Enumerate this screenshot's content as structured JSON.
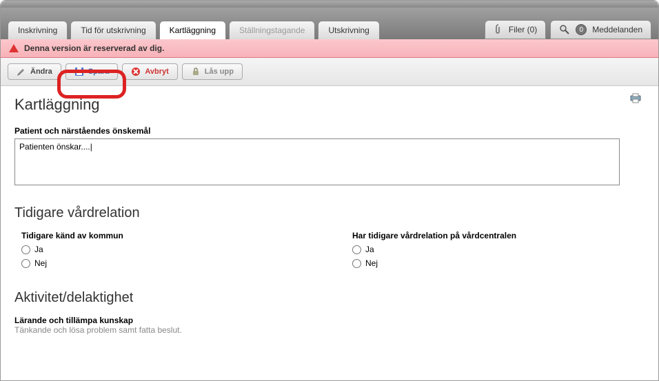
{
  "tabs": {
    "inskrivning": "Inskrivning",
    "tid": "Tid för utskrivning",
    "kartlaggning": "Kartläggning",
    "stallning": "Ställningstagande",
    "utskrivning": "Utskrivning"
  },
  "rightTabs": {
    "filer": "Filer (0)",
    "meddelanden": "Meddelanden",
    "meddelanden_count": "0"
  },
  "alert": {
    "message": "Denna version är reserverad av dig."
  },
  "toolbar": {
    "andra": "Ändra",
    "spara": "Spara",
    "avbryt": "Avbryt",
    "lasupp": "Lås upp"
  },
  "page": {
    "title": "Kartläggning"
  },
  "fields": {
    "onskemal_label": "Patient och närståendes önskemål",
    "onskemal_value": "Patienten önskar....|"
  },
  "section_tidigare": {
    "title": "Tidigare vårdrelation",
    "q1_label": "Tidigare känd av kommun",
    "q2_label": "Har tidigare vårdrelation på vårdcentralen",
    "ja": "Ja",
    "nej": "Nej"
  },
  "section_aktivitet": {
    "title": "Aktivitet/delaktighet",
    "sub1": "Lärande och tillämpa kunskap",
    "sub1_desc": "Tänkande och lösa problem samt fatta beslut."
  }
}
